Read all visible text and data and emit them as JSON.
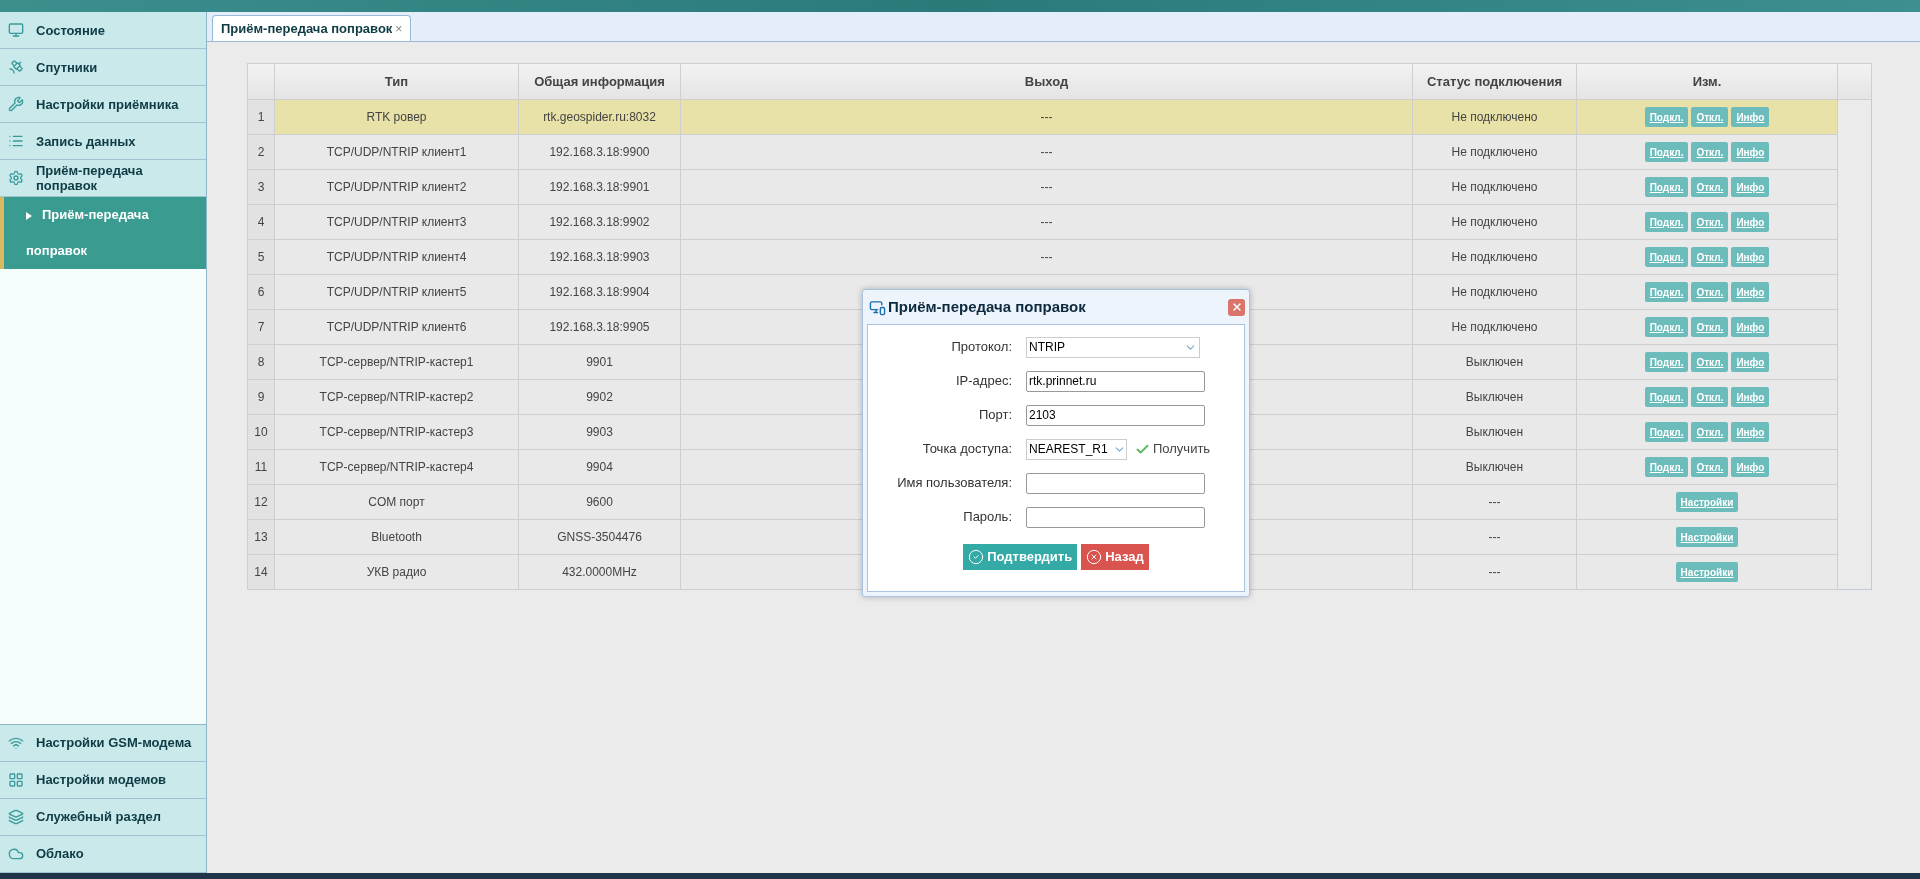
{
  "sidebar": {
    "items": [
      {
        "label": "Состояние",
        "selected": false
      },
      {
        "label": "Спутники",
        "selected": false
      },
      {
        "label": "Настройки приёмника",
        "selected": false
      },
      {
        "label": "Запись данных",
        "selected": false
      },
      {
        "label": "Приём-передача поправок",
        "selected": false,
        "children": [
          {
            "label": "Приём-передача поправок",
            "selected": true
          }
        ]
      }
    ],
    "bottom_items": [
      {
        "label": "Настройки GSM-модема"
      },
      {
        "label": "Настройки модемов"
      },
      {
        "label": "Служебный раздел"
      },
      {
        "label": "Облако"
      }
    ]
  },
  "tabs": [
    {
      "label": "Приём-передача поправок",
      "close": "×",
      "selected": true
    }
  ],
  "table": {
    "columns": [
      "Тип",
      "Общая информация",
      "Выход",
      "Статус подключения",
      "Изм."
    ],
    "rows": [
      {
        "n": "1",
        "type": "RTK ровер",
        "info": "rtk.geospider.ru:8032",
        "output": "---",
        "status": "Не подключено",
        "selected": true,
        "actions": [
          "Подкл.",
          "Откл.",
          "Инфо"
        ]
      },
      {
        "n": "2",
        "type": "TCP/UDP/NTRIP клиент1",
        "info": "192.168.3.18:9900",
        "output": "---",
        "status": "Не подключено",
        "selected": false,
        "actions": [
          "Подкл.",
          "Откл.",
          "Инфо"
        ]
      },
      {
        "n": "3",
        "type": "TCP/UDP/NTRIP клиент2",
        "info": "192.168.3.18:9901",
        "output": "---",
        "status": "Не подключено",
        "selected": false,
        "actions": [
          "Подкл.",
          "Откл.",
          "Инфо"
        ]
      },
      {
        "n": "4",
        "type": "TCP/UDP/NTRIP клиент3",
        "info": "192.168.3.18:9902",
        "output": "---",
        "status": "Не подключено",
        "selected": false,
        "actions": [
          "Подкл.",
          "Откл.",
          "Инфо"
        ]
      },
      {
        "n": "5",
        "type": "TCP/UDP/NTRIP клиент4",
        "info": "192.168.3.18:9903",
        "output": "---",
        "status": "Не подключено",
        "selected": false,
        "actions": [
          "Подкл.",
          "Откл.",
          "Инфо"
        ]
      },
      {
        "n": "6",
        "type": "TCP/UDP/NTRIP клиент5",
        "info": "192.168.3.18:9904",
        "status": "Не подключено",
        "selected": false,
        "actions": [
          "Подкл.",
          "Откл.",
          "Инфо"
        ]
      },
      {
        "n": "7",
        "type": "TCP/UDP/NTRIP клиент6",
        "info": "192.168.3.18:9905",
        "status": "Не подключено",
        "selected": false,
        "actions": [
          "Подкл.",
          "Откл.",
          "Инфо"
        ]
      },
      {
        "n": "8",
        "type": "TCP-сервер/NTRIP-кастер1",
        "info": "9901",
        "status": "Выключен",
        "selected": false,
        "actions": [
          "Подкл.",
          "Откл.",
          "Инфо"
        ]
      },
      {
        "n": "9",
        "type": "TCP-сервер/NTRIP-кастер2",
        "info": "9902",
        "status": "Выключен",
        "selected": false,
        "actions": [
          "Подкл.",
          "Откл.",
          "Инфо"
        ]
      },
      {
        "n": "10",
        "type": "TCP-сервер/NTRIP-кастер3",
        "info": "9903",
        "status": "Выключен",
        "selected": false,
        "actions": [
          "Подкл.",
          "Откл.",
          "Инфо"
        ]
      },
      {
        "n": "11",
        "type": "TCP-сервер/NTRIP-кастер4",
        "info": "9904",
        "status": "Выключен",
        "selected": false,
        "actions": [
          "Подкл.",
          "Откл.",
          "Инфо"
        ]
      },
      {
        "n": "12",
        "type": "COM порт",
        "info": "9600",
        "status": "---",
        "selected": false,
        "actions": [
          "Настройки"
        ]
      },
      {
        "n": "13",
        "type": "Bluetooth",
        "info": "GNSS-3504476",
        "status": "---",
        "selected": false,
        "actions": [
          "Настройки"
        ]
      },
      {
        "n": "14",
        "type": "УКВ радио",
        "info": "432.0000MHz",
        "status": "---",
        "selected": false,
        "actions": [
          "Настройки"
        ]
      }
    ]
  },
  "dialog": {
    "title": "Приём-передача поправок",
    "fields": [
      {
        "kind": "select",
        "label": "Протокол:",
        "value": "NTRIP"
      },
      {
        "kind": "text",
        "label": "IP-адрес:",
        "value": "rtk.prinnet.ru"
      },
      {
        "kind": "text",
        "label": "Порт:",
        "value": "2103"
      },
      {
        "kind": "fetch",
        "label": "Точка доступа:",
        "value": "NEAREST_R1",
        "action": "Получить"
      },
      {
        "kind": "text",
        "label": "Имя пользователя:"
      },
      {
        "kind": "password",
        "label": "Пароль:"
      }
    ],
    "buttons": [
      {
        "kind": "confirm",
        "label": "Подтвердить"
      },
      {
        "kind": "cancel",
        "label": "Назад"
      }
    ]
  }
}
